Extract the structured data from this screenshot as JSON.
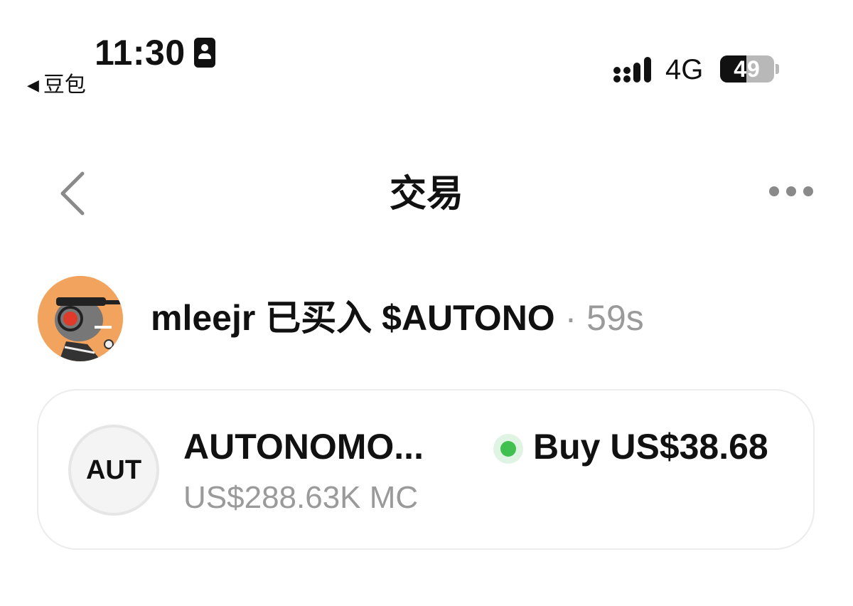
{
  "status_bar": {
    "time": "11:30",
    "back_app": "豆包",
    "network": "4G",
    "battery": "49",
    "battery_level": 0.49
  },
  "nav": {
    "title": "交易"
  },
  "activity": {
    "user": "mleejr",
    "action": "已买入",
    "ticker": "$AUTONO",
    "separator": "·",
    "age": "59s"
  },
  "token": {
    "logo_text": "AUT",
    "name": "AUTONOMO...",
    "market_cap": "US$288.63K MC",
    "trade": "Buy US$38.68",
    "status_color": "#3fc04f"
  },
  "icons": {
    "id_badge": "contact-card-icon",
    "signal": "cellular-signal-icon",
    "back": "chevron-left-icon",
    "more": "more-horizontal-icon",
    "status": "green-dot-icon"
  }
}
